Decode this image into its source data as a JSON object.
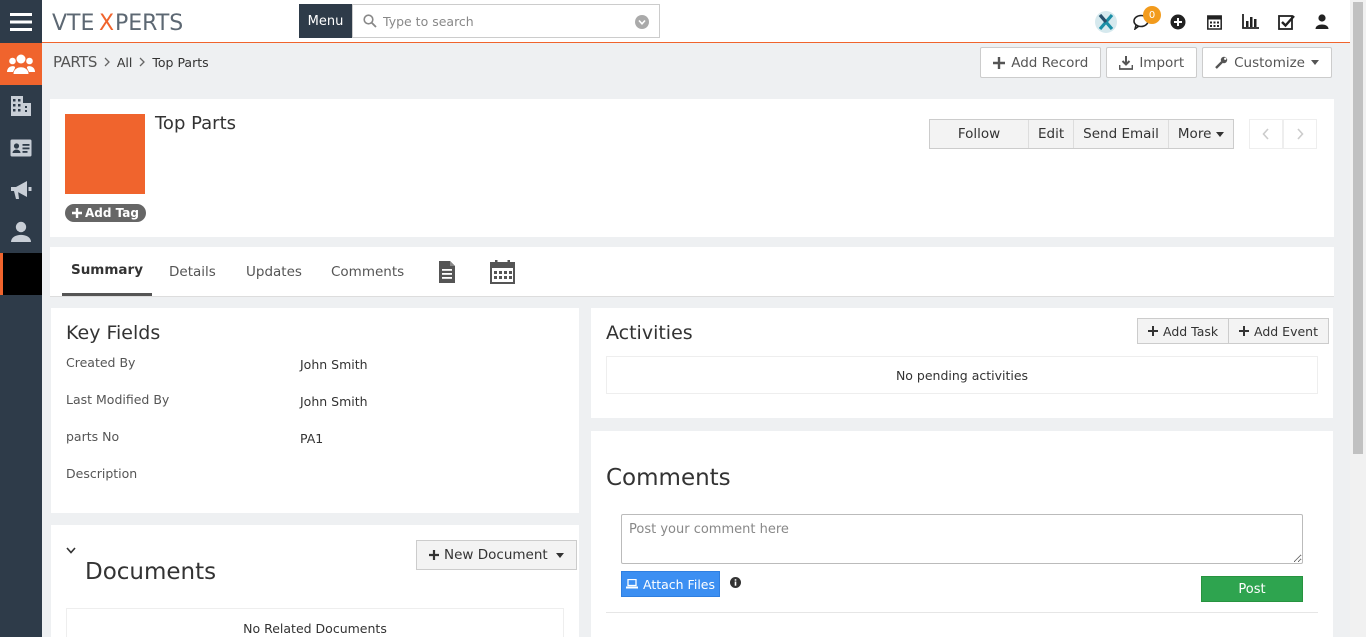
{
  "brand": {
    "logo_text": "VTEXPERTS",
    "accent": "#f0642d",
    "sidebar_bg": "#2e3b49"
  },
  "topbar": {
    "menu_label": "Menu",
    "search_placeholder": "Type to search",
    "notification_count": "0",
    "icons": [
      "x-app-icon",
      "chat-icon",
      "plus-circle-icon",
      "calendar-icon",
      "reports-icon",
      "tasks-icon",
      "user-icon"
    ]
  },
  "sidebar": {
    "items": [
      "contacts-icon",
      "organizations-icon",
      "vcard-icon",
      "campaigns-icon",
      "person-icon",
      "black-item"
    ]
  },
  "breadcrumb": {
    "module": "PARTS",
    "filter": "All",
    "record": "Top Parts"
  },
  "header_actions": {
    "add_record": "Add Record",
    "import": "Import",
    "customize": "Customize"
  },
  "record": {
    "title": "Top Parts",
    "add_tag": "Add Tag",
    "actions": {
      "follow": "Follow",
      "edit": "Edit",
      "send_email": "Send Email",
      "more": "More"
    }
  },
  "tabs": [
    "Summary",
    "Details",
    "Updates",
    "Comments"
  ],
  "key_fields": {
    "title": "Key Fields",
    "rows": [
      {
        "label": "Created By",
        "value": "John Smith"
      },
      {
        "label": "Last Modified By",
        "value": "John Smith"
      },
      {
        "label": "parts No",
        "value": "PA1"
      },
      {
        "label": "Description",
        "value": ""
      }
    ]
  },
  "documents": {
    "title": "Documents",
    "new_document": "New Document",
    "empty": "No Related Documents"
  },
  "activities": {
    "title": "Activities",
    "add_task": "Add Task",
    "add_event": "Add Event",
    "empty": "No pending activities"
  },
  "comments": {
    "title": "Comments",
    "placeholder": "Post your comment here",
    "attach": "Attach Files",
    "post": "Post"
  }
}
